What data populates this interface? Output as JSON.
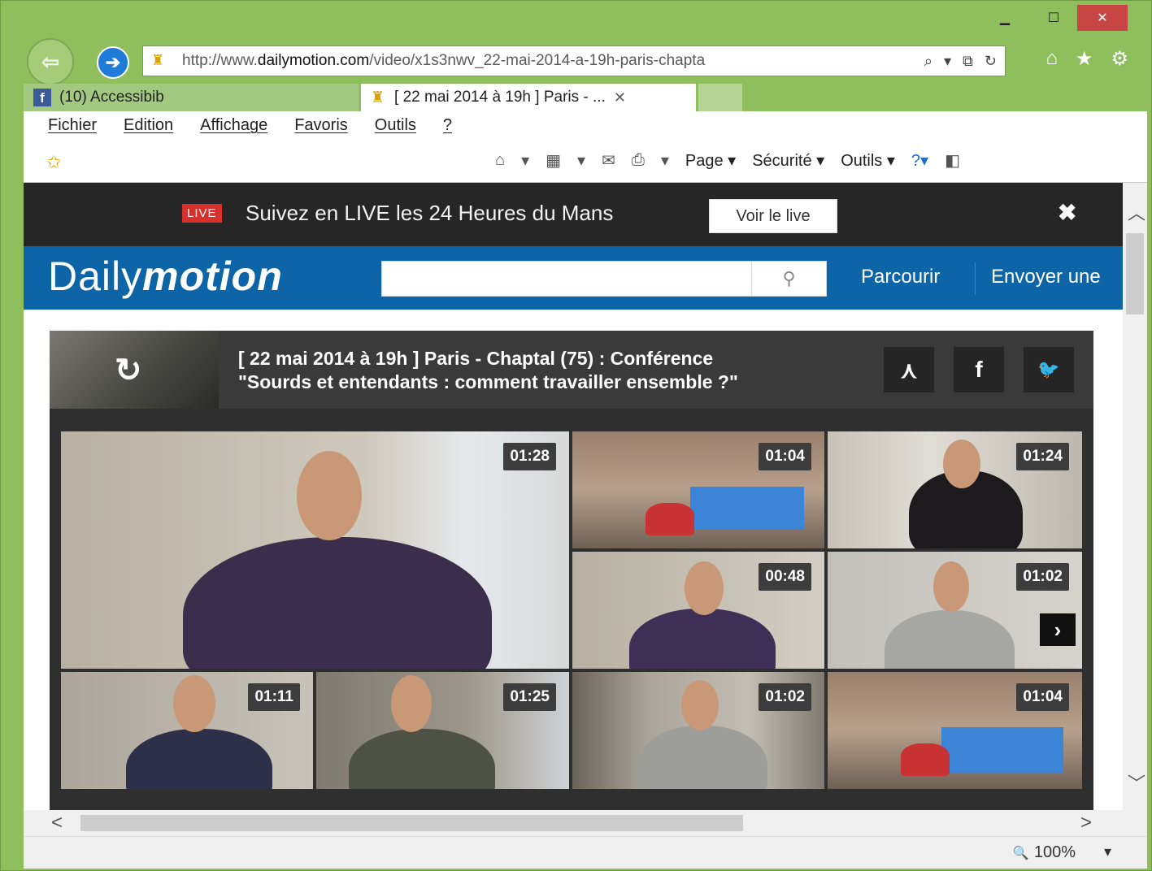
{
  "window": {
    "minimize": "▁",
    "maximize": "☐",
    "close": "✕"
  },
  "nav": {
    "back": "⇦",
    "forward": "➔"
  },
  "address": {
    "url_prefix": "http://www.",
    "url_domain": "dailymotion.com",
    "url_path": "/video/x1s3nwv_22-mai-2014-a-19h-paris-chapta",
    "search_icon": "⌕",
    "dropdown": "▾",
    "compat_icon": "⧉",
    "refresh_icon": "↻"
  },
  "browser_icons": {
    "home": "⌂",
    "favorites": "★",
    "settings": "⚙"
  },
  "tabs": [
    {
      "label": "(10) Accessibib",
      "icon": "facebook-icon"
    },
    {
      "label": "[ 22 mai 2014 à 19h ] Paris - ...",
      "icon": "lock-icon",
      "close": "✕"
    }
  ],
  "menu": [
    "Fichier",
    "Edition",
    "Affichage",
    "Favoris",
    "Outils",
    "?"
  ],
  "commandbar": {
    "favorites_star": "✩",
    "home": "⌂",
    "feeds": "▦",
    "mail": "✉",
    "print": "⎙",
    "page": "Page ▾",
    "security": "Sécurité ▾",
    "tools": "Outils ▾",
    "help": "?▾",
    "research": "◧",
    "arrow": "▾"
  },
  "livebar": {
    "badge": "LIVE",
    "text": "Suivez en LIVE les 24 Heures du Mans",
    "button": "Voir le live",
    "close": "✖"
  },
  "site": {
    "logo_plain": "Daily",
    "logo_bold": "motion",
    "search_placeholder": "",
    "search_icon": "⚲",
    "links": [
      "Parcourir",
      "Envoyer une"
    ]
  },
  "player": {
    "replay_icon": "↻",
    "title_line1": "[ 22 mai 2014 à 19h ] Paris - Chaptal (75) : Conférence",
    "title_line2": "\"Sourds et entendants : comment travailler ensemble ?\"",
    "share_icon": "⋏",
    "facebook": "f",
    "twitter": "🐦",
    "next": "›",
    "videos": [
      {
        "duration": "01:28"
      },
      {
        "duration": "01:04"
      },
      {
        "duration": "01:24"
      },
      {
        "duration": "00:48"
      },
      {
        "duration": "01:02"
      },
      {
        "duration": "01:11"
      },
      {
        "duration": "01:25"
      },
      {
        "duration": "01:02"
      },
      {
        "duration": "01:04"
      }
    ]
  },
  "scroll": {
    "up": "︿",
    "down": "﹀",
    "left": "<",
    "right": ">"
  },
  "status": {
    "zoom_icon": "🔍",
    "zoom": "100%",
    "zoom_arrow": "▾"
  }
}
